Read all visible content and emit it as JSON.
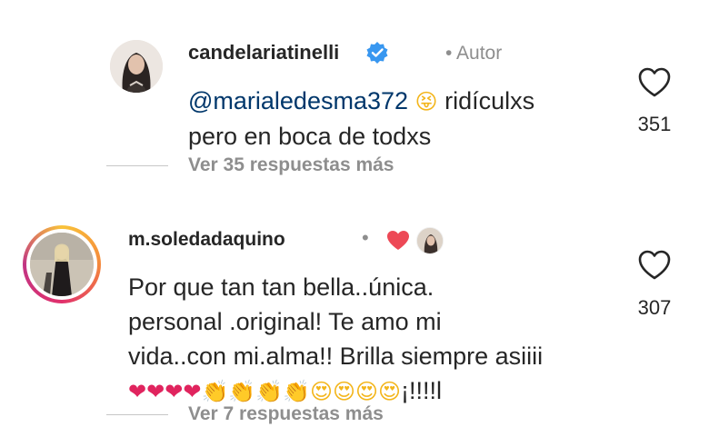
{
  "comments": [
    {
      "username": "candelariatinelli",
      "author_badge": "• Autor",
      "mention": "@marialedesma372",
      "emoji": "😝",
      "text_line1": "ridículxs",
      "text_line2": "pero en boca de todxs",
      "likes": "351",
      "replies_label": "Ver 35 respuestas más"
    },
    {
      "username": "m.soledadaquino",
      "dot": "•",
      "text_line1": "Por que tan tan bella..única.",
      "text_line2": "personal .original! Te  amo mi",
      "text_line3": "vida..con mi.alma!! Brilla siempre asiiii",
      "hearts": "❤❤❤❤",
      "clap": "👏👏👏👏",
      "eyes": "😍😍😍😍",
      "tail": "¡!!!!l",
      "likes": "307",
      "replies_label": "Ver 7 respuestas más"
    }
  ]
}
